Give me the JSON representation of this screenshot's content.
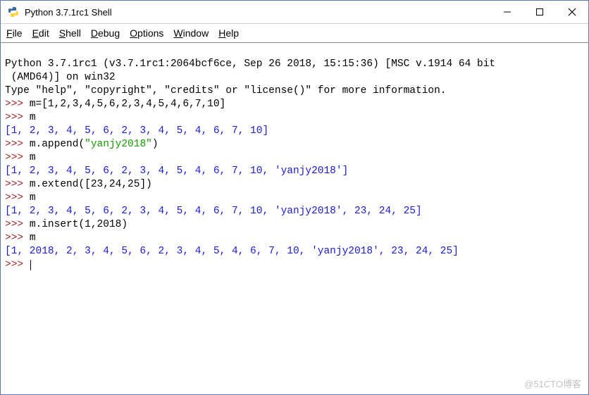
{
  "title": "Python 3.7.1rc1 Shell",
  "menu": {
    "file": {
      "key": "F",
      "rest": "ile"
    },
    "edit": {
      "key": "E",
      "rest": "dit"
    },
    "shell": {
      "key": "S",
      "rest": "hell"
    },
    "debug": {
      "key": "D",
      "rest": "ebug"
    },
    "options": {
      "key": "O",
      "rest": "ptions"
    },
    "window": {
      "key": "W",
      "rest": "indow"
    },
    "help": {
      "key": "H",
      "rest": "elp"
    }
  },
  "banner": {
    "l1": "Python 3.7.1rc1 (v3.7.1rc1:2064bcf6ce, Sep 26 2018, 15:15:36) [MSC v.1914 64 bit",
    "l2": " (AMD64)] on win32",
    "l3": "Type \"help\", \"copyright\", \"credits\" or \"license()\" for more information."
  },
  "prompt": ">>> ",
  "lines": {
    "c1": "m=[1,2,3,4,5,6,2,3,4,5,4,6,7,10]",
    "c2": "m",
    "o1": "[1, 2, 3, 4, 5, 6, 2, 3, 4, 5, 4, 6, 7, 10]",
    "c3a": "m.append(",
    "c3s": "\"yanjy2018\"",
    "c3b": ")",
    "c4": "m",
    "o2": "[1, 2, 3, 4, 5, 6, 2, 3, 4, 5, 4, 6, 7, 10, 'yanjy2018']",
    "c5": "m.extend([23,24,25])",
    "c6": "m",
    "o3": "[1, 2, 3, 4, 5, 6, 2, 3, 4, 5, 4, 6, 7, 10, 'yanjy2018', 23, 24, 25]",
    "c7": "m.insert(1,2018)",
    "c8": "m",
    "o4": "[1, 2018, 2, 3, 4, 5, 6, 2, 3, 4, 5, 4, 6, 7, 10, 'yanjy2018', 23, 24, 25]"
  },
  "watermark": "@51CTO博客"
}
